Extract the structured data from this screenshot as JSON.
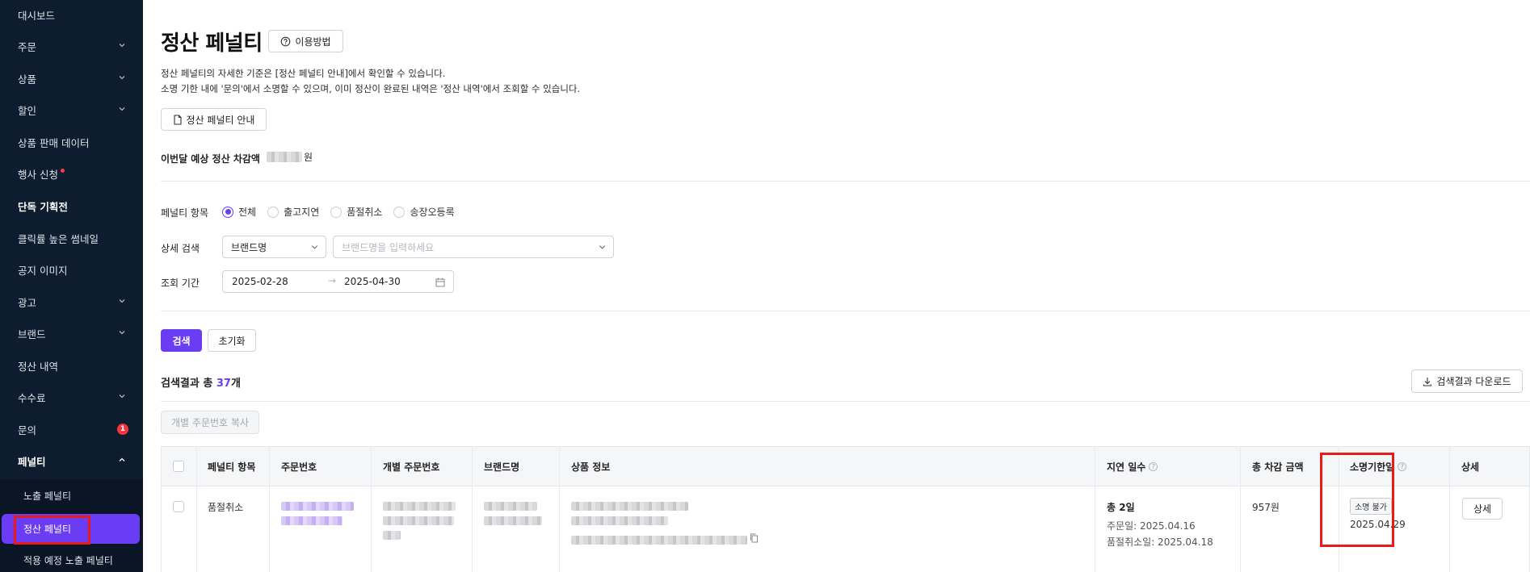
{
  "sidebar": {
    "items": [
      {
        "label": "대시보드"
      },
      {
        "label": "주문"
      },
      {
        "label": "상품"
      },
      {
        "label": "할인"
      },
      {
        "label": "상품 판매 데이터"
      },
      {
        "label": "행사 신청"
      },
      {
        "label": "단독 기획전"
      },
      {
        "label": "클릭률 높은 썸네일"
      },
      {
        "label": "공지 이미지"
      },
      {
        "label": "광고"
      },
      {
        "label": "브랜드"
      },
      {
        "label": "정산 내역"
      },
      {
        "label": "수수료"
      },
      {
        "label": "문의",
        "badge": "1"
      },
      {
        "label": "페널티"
      }
    ],
    "sub_items": [
      {
        "label": "노출 페널티"
      },
      {
        "label": "정산 페널티"
      },
      {
        "label": "적용 예정 노출 페널티"
      }
    ],
    "colors": {
      "background": "#0d1c2e",
      "active": "#6a3df5",
      "alert": "#f5333f"
    }
  },
  "page": {
    "title": "정산 페널티",
    "howto_label": "이용방법",
    "desc_line1": "정산 페널티의 자세한 기준은 [정산 페널티 안내]에서 확인할 수 있습니다.",
    "desc_line2": "소명 기한 내에 '문의'에서 소명할 수 있으며, 이미 정산이 완료된 내역은 '정산 내역'에서 조회할 수 있습니다.",
    "guide_label": "정산 페널티 안내",
    "deduction_label": "이번달 예상 정산 차감액",
    "deduction_unit": "원"
  },
  "filters": {
    "penalty_label": "페널티 항목",
    "penalty_options": [
      "전체",
      "출고지연",
      "품절취소",
      "송장오등록"
    ],
    "penalty_selected": "전체",
    "detail_label": "상세 검색",
    "detail_select": "브랜드명",
    "detail_placeholder": "브랜드명을 입력하세요",
    "period_label": "조회 기간",
    "date_from": "2025-02-28",
    "date_to": "2025-04-30",
    "search_button": "검색",
    "reset_button": "초기화"
  },
  "results": {
    "prefix": "검색결과 총 ",
    "count": "37",
    "suffix": "개",
    "download_label": "검색결과 다운로드",
    "copy_label": "개별 주문번호 복사"
  },
  "table": {
    "columns": [
      "페널티 항목",
      "주문번호",
      "개별 주문번호",
      "브랜드명",
      "상품 정보",
      "지연 일수",
      "총 차감 금액",
      "소명기한일",
      "상세"
    ],
    "rows": [
      {
        "penalty": "품절취소",
        "delay_total": "총 2일",
        "order_date": "주문일: 2025.04.16",
        "cancel_date": "품절취소일: 2025.04.18",
        "amount": "957원",
        "appeal_status": "소명 불가",
        "appeal_deadline": "2025.04.29",
        "detail_button": "상세"
      }
    ]
  },
  "theme": {
    "accent": "#6a3df5",
    "highlight_box": "#e81b1b"
  }
}
